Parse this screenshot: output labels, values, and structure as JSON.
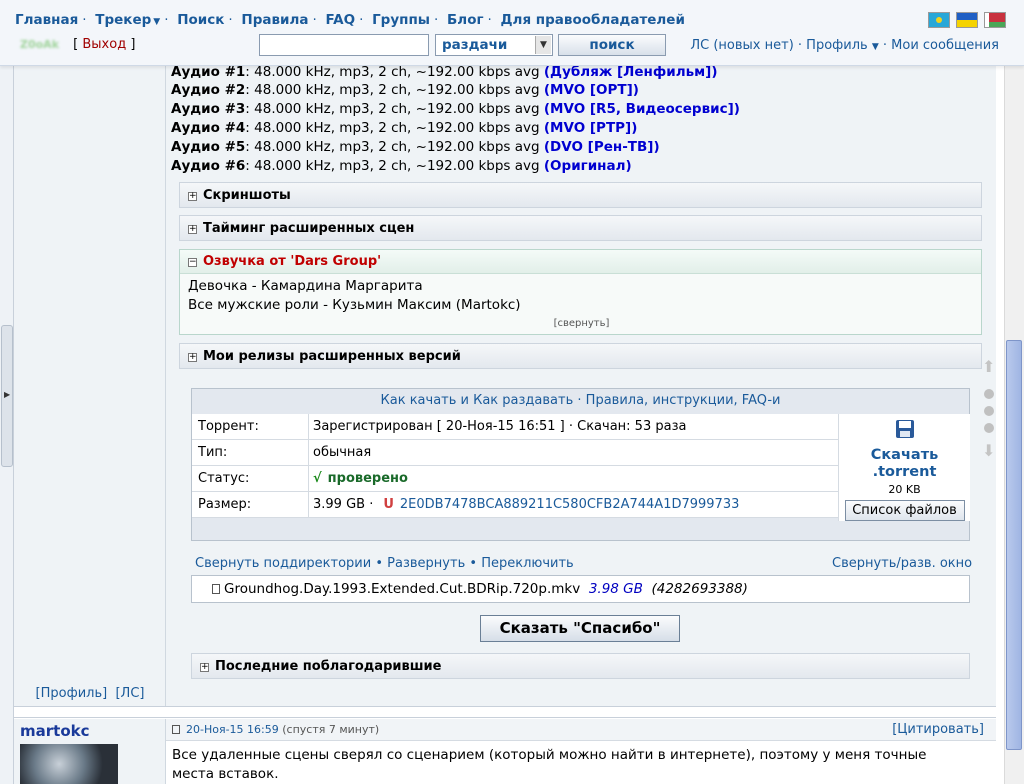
{
  "nav": {
    "items": [
      "Главная",
      "Трекер",
      "Поиск",
      "Правила",
      "FAQ",
      "Группы",
      "Блог",
      "Для правообладателей"
    ],
    "separator": "·"
  },
  "user": {
    "name": "Z0oAk",
    "logout": "Выход"
  },
  "search": {
    "value": "",
    "select": "раздачи",
    "button": "поиск"
  },
  "right_links": {
    "pm": "ЛС (новых нет)",
    "profile": "Профиль",
    "my_posts": "Мои сообщения"
  },
  "audio": [
    {
      "label": "Аудио #1",
      "spec": ": 48.000 kHz, mp3, 2 ch, ~192.00 kbps avg ",
      "note": "(Дубляж [Ленфильм])"
    },
    {
      "label": "Аудио #2",
      "spec": ": 48.000 kHz, mp3, 2 ch, ~192.00 kbps avg ",
      "note": "(MVO [ОРТ])"
    },
    {
      "label": "Аудио #3",
      "spec": ": 48.000 kHz, mp3, 2 ch, ~192.00 kbps avg ",
      "note": "(MVO [R5, Видеосервис])"
    },
    {
      "label": "Аудио #4",
      "spec": ": 48.000 kHz, mp3, 2 ch, ~192.00 kbps avg ",
      "note": "(MVO [РТР])"
    },
    {
      "label": "Аудио #5",
      "spec": ": 48.000 kHz, mp3, 2 ch, ~192.00 kbps avg ",
      "note": "(DVO [Рен-ТВ])"
    },
    {
      "label": "Аудио #6",
      "spec": ": 48.000 kHz, mp3, 2 ch, ~192.00 kbps avg ",
      "note": "(Оригинал)"
    }
  ],
  "spoilers": {
    "screenshots": "Скриншоты",
    "timing": "Тайминг расширенных сцен",
    "voice": "Озвучка от 'Dars Group'",
    "releases": "Мои релизы расширенных версий",
    "thanked": "Последние поблагодарившие"
  },
  "voice": {
    "line1": "Девочка - Камардина Маргарита",
    "line2": "Все мужские роли - Кузьмин Максим (Martokc)",
    "collapse": "[свернуть]"
  },
  "torrent": {
    "head_link1": "Как качать и Как раздавать",
    "head_sep": "·",
    "head_link2": "Правила, инструкции, FAQ-и",
    "rows": {
      "torrent_k": "Торрент:",
      "torrent_v": "Зарегистрирован  [ 20-Ноя-15 16:51 ]  ·  Скачан: 53 раза",
      "type_k": "Тип:",
      "type_v": "обычная",
      "status_k": "Статус:",
      "status_check": "√",
      "status_v": "проверено",
      "size_k": "Размер:",
      "size_v": "3.99 GB  ·",
      "hash": "2E0DB7478BCA889211C580CFB2A744A1D7999733"
    },
    "download": {
      "line1": "Скачать",
      "line2": ".torrent",
      "size": "20 KB",
      "filelist": "Список файлов"
    }
  },
  "tree": {
    "collapse_dirs": "Свернуть поддиректории",
    "bullet": "•",
    "expand": "Развернуть",
    "toggle": "Переключить",
    "window": "Свернуть/разв. окно"
  },
  "file": {
    "name": "Groundhog.Day.1993.Extended.Cut.BDRip.720p.mkv",
    "size": "3.98 GB",
    "bytes": "(4282693388)"
  },
  "thanks_button": "Сказать \"Спасибо\"",
  "profile_links": {
    "profile": "[Профиль]",
    "pm": "[ЛС]"
  },
  "post2": {
    "author": "martokc",
    "date": "20-Ноя-15 16:59",
    "after": "(спустя 7 минут)",
    "quote": "[Цитировать]",
    "body": "Все удаленные сцены сверял со сценарием (который можно найти в интернете), поэтому у меня точные места вставок."
  },
  "colors": {
    "link": "#1a5a9a",
    "audio_note": "#0000d0",
    "voice_title": "#c00000",
    "checked": "#1a8a1a"
  }
}
